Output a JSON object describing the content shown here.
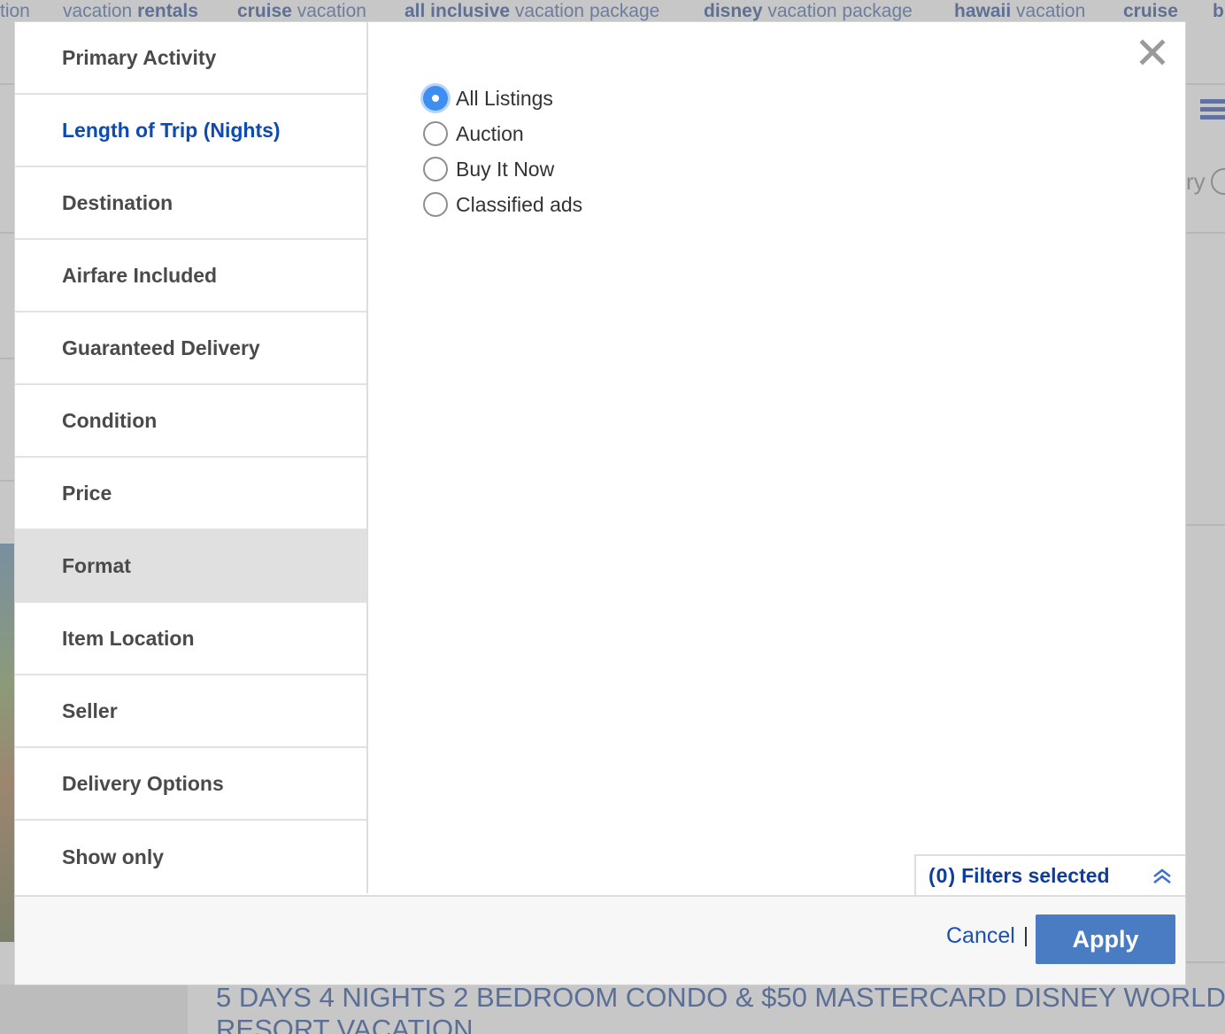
{
  "background": {
    "related_searches": [
      {
        "bold": "",
        "rest": "tion"
      },
      {
        "bold": "",
        "rest": "vacation "
      },
      {
        "bold": "rentals",
        "rest": ""
      },
      {
        "bold": "cruise",
        "rest": " vacation"
      },
      {
        "bold": "all inclusive",
        "rest": " vacation package"
      },
      {
        "bold": "disney",
        "rest": " vacation package"
      },
      {
        "bold": "hawaii",
        "rest": " vacation"
      },
      {
        "bold": "cruise",
        "rest": ""
      },
      {
        "bold": "b",
        "rest": ""
      }
    ],
    "listing_title_line1": "5 DAYS 4 NIGHTS 2 BEDROOM CONDO & $50 MASTERCARD DISNEY WORLD",
    "listing_title_line2": "RESORT VACATION",
    "fragment_ry": "ry"
  },
  "dialog": {
    "sidebar": {
      "items": [
        {
          "label": "Primary Activity"
        },
        {
          "label": "Length of Trip (Nights)"
        },
        {
          "label": "Destination"
        },
        {
          "label": "Airfare Included"
        },
        {
          "label": "Guaranteed Delivery"
        },
        {
          "label": "Condition"
        },
        {
          "label": "Price"
        },
        {
          "label": "Format"
        },
        {
          "label": "Item Location"
        },
        {
          "label": "Seller"
        },
        {
          "label": "Delivery Options"
        },
        {
          "label": "Show only"
        }
      ],
      "selected_index": 7,
      "highlighted_index": 1
    },
    "format_options": [
      {
        "label": "All Listings",
        "checked": true
      },
      {
        "label": "Auction",
        "checked": false
      },
      {
        "label": "Buy It Now",
        "checked": false
      },
      {
        "label": "Classified ads",
        "checked": false
      }
    ],
    "filters_tab": {
      "count": "(0)",
      "label": "Filters selected",
      "icon": "double-chevron-up-icon"
    },
    "footer": {
      "cancel_label": "Cancel",
      "apply_label": "Apply"
    },
    "close_icon": "close-icon",
    "colors": {
      "link_blue": "#0f4baf",
      "apply_bg": "#4a7cc3",
      "radio_checked": "#3d8ef0",
      "selected_row_bg": "#e0e0e0"
    }
  }
}
